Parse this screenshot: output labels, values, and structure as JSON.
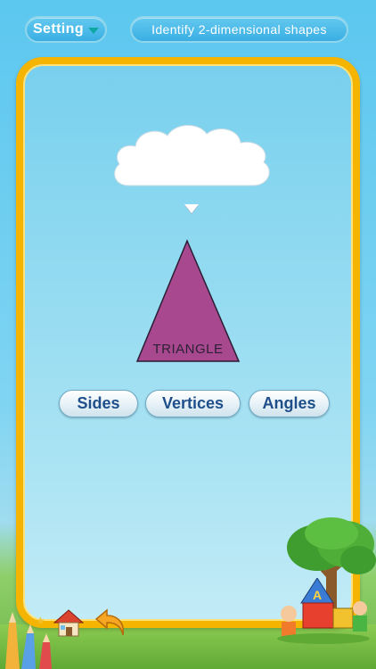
{
  "header": {
    "setting_label": "Setting",
    "topic_label": "Identify 2-dimensional shapes"
  },
  "shape": {
    "label": "TRIANGLE",
    "fill_color": "#a8498f"
  },
  "buttons": {
    "sides": "Sides",
    "vertices": "Vertices",
    "angles": "Angles"
  },
  "icons": {
    "settings_dropdown": "chevron-down-icon",
    "home": "home-icon",
    "back": "back-arrow-icon"
  },
  "colors": {
    "frame_border": "#f4b400",
    "button_text": "#1e4f8a",
    "header_pill": "#3aaee3"
  }
}
